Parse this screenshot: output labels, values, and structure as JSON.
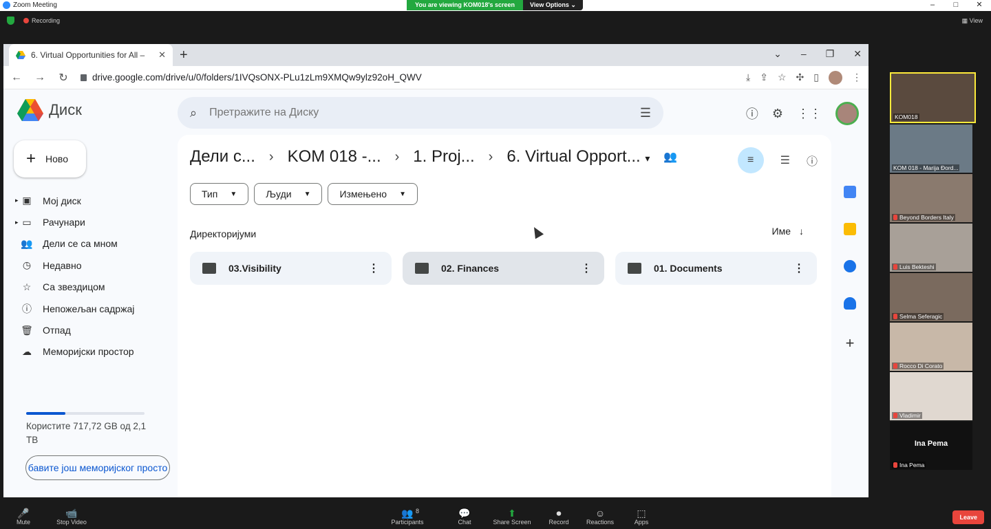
{
  "zoom": {
    "window_title": "Zoom Meeting",
    "viewing_banner": "You are viewing KOM018's screen",
    "view_options": "View Options",
    "recording": "Recording",
    "view": "View",
    "window_controls": [
      "–",
      "□",
      "✕"
    ],
    "participants_count": "8",
    "toolbar": [
      {
        "label": "Mute",
        "icon": "microphone-icon",
        "glyph": "🎤"
      },
      {
        "label": "Stop Video",
        "icon": "camera-icon",
        "glyph": "📹"
      },
      {
        "label": "Participants",
        "icon": "participants-icon",
        "glyph": "👥"
      },
      {
        "label": "Chat",
        "icon": "chat-icon",
        "glyph": "💬"
      },
      {
        "label": "Share Screen",
        "icon": "share-screen-icon",
        "glyph": "⬆"
      },
      {
        "label": "Record",
        "icon": "record-icon",
        "glyph": "⏺"
      },
      {
        "label": "Reactions",
        "icon": "reactions-icon",
        "glyph": "☺"
      },
      {
        "label": "Apps",
        "icon": "apps-icon",
        "glyph": "⬚"
      }
    ],
    "leave": "Leave",
    "participants": [
      {
        "name": "KOM018",
        "muted": false
      },
      {
        "name": "KOM 018 - Marija Đord...",
        "muted": false
      },
      {
        "name": "Beyond Borders Italy",
        "muted": true
      },
      {
        "name": "Luis Bekteshi",
        "muted": true
      },
      {
        "name": "Selma Seferagic",
        "muted": true
      },
      {
        "name": "Rocco Di Corato",
        "muted": true
      },
      {
        "name": "Vladimir",
        "muted": true
      },
      {
        "name": "Ina Pema",
        "muted": true
      }
    ],
    "no_video_name": "Ina Pema"
  },
  "browser": {
    "tab_title": "6. Virtual Opportunities for All – ",
    "tab_close": "✕",
    "new_tab": "+",
    "strip_controls": [
      "⌄",
      "–",
      "❐",
      "✕"
    ],
    "url": "drive.google.com/drive/u/0/folders/1IVQsONX-PLu1zLm9XMQw9ylz92oH_QWV"
  },
  "drive": {
    "app_name": "Диск",
    "search_placeholder": "Претражите на Диску",
    "new_label": "Ново",
    "nav": [
      {
        "label": "Мој диск",
        "icon": "my-drive-icon",
        "glyph": "▣",
        "expand": true
      },
      {
        "label": "Рачунари",
        "icon": "computer-icon",
        "glyph": "▭",
        "expand": true
      },
      {
        "label": "Дели се са мном",
        "icon": "shared-people-icon",
        "glyph": "👥",
        "expand": false
      },
      {
        "label": "Недавно",
        "icon": "clock-icon",
        "glyph": "◷",
        "expand": false
      },
      {
        "label": "Са звездицом",
        "icon": "star-icon",
        "glyph": "☆",
        "expand": false
      },
      {
        "label": "Непожељан садржај",
        "icon": "spam-icon",
        "glyph": "ⓘ",
        "expand": false
      },
      {
        "label": "Отпад",
        "icon": "trash-icon",
        "glyph": "🗑",
        "expand": false
      },
      {
        "label": "Меморијски простор",
        "icon": "cloud-icon",
        "glyph": "☁",
        "expand": false
      }
    ],
    "storage_fraction": 0.33,
    "storage_text": "Користите 717,72 GB од 2,1 TB",
    "get_more": "бавите још меморијског просто",
    "breadcrumbs": [
      "Дели с...",
      "KOM 018 -...",
      "1. Proj...",
      "6. Virtual Opport..."
    ],
    "filters": [
      "Тип",
      "Људи",
      "Измењено"
    ],
    "section_title": "Директоријуми",
    "sort_label": "Име",
    "folders": [
      "03.Visibility",
      "02. Finances",
      "01. Documents"
    ]
  }
}
